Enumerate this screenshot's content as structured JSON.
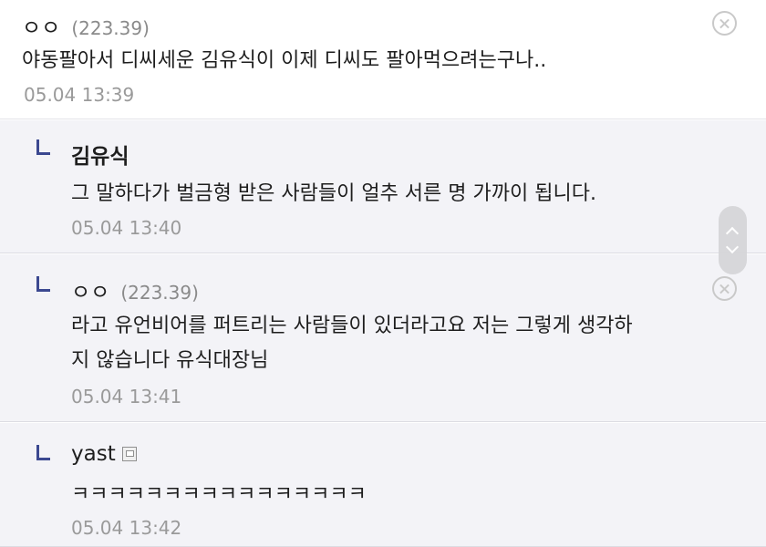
{
  "comments": [
    {
      "nick": "ㅇㅇ",
      "ip": "(223.39)",
      "text": "야동팔아서 디씨세운 김유식이 이제 디씨도 팔아먹으려는구나..",
      "date": "05.04 13:39"
    }
  ],
  "replies": [
    {
      "nick": "김유식",
      "lines": [
        "그 말하다가 벌금형 받은 사람들이 얼추 서른 명 가까이 됩니다."
      ],
      "date": "05.04 13:40"
    },
    {
      "nick": "ㅇㅇ",
      "ip": "(223.39)",
      "lines": [
        "라고 유언비어를 퍼트리는 사람들이 있더라고요 저는 그렇게 생각하",
        "지 않습니다 유식대장님"
      ],
      "date": "05.04 13:41"
    },
    {
      "nick": "yast",
      "lines": [
        "ㅋㅋㅋㅋㅋㅋㅋㅋㅋㅋㅋㅋㅋㅋㅋㅋ"
      ],
      "date": "05.04 13:42"
    }
  ],
  "colors": {
    "reply_background": "#f3f3f7",
    "reply_marker": "#3b4890",
    "date_text": "#9a9a9a",
    "ip_text": "#8a8a8a"
  },
  "icons": {
    "delete": "close-circle-icon",
    "reply": "reply-arrow-icon",
    "gallog": "gallog-icon",
    "scroll": "scroll-handle"
  }
}
